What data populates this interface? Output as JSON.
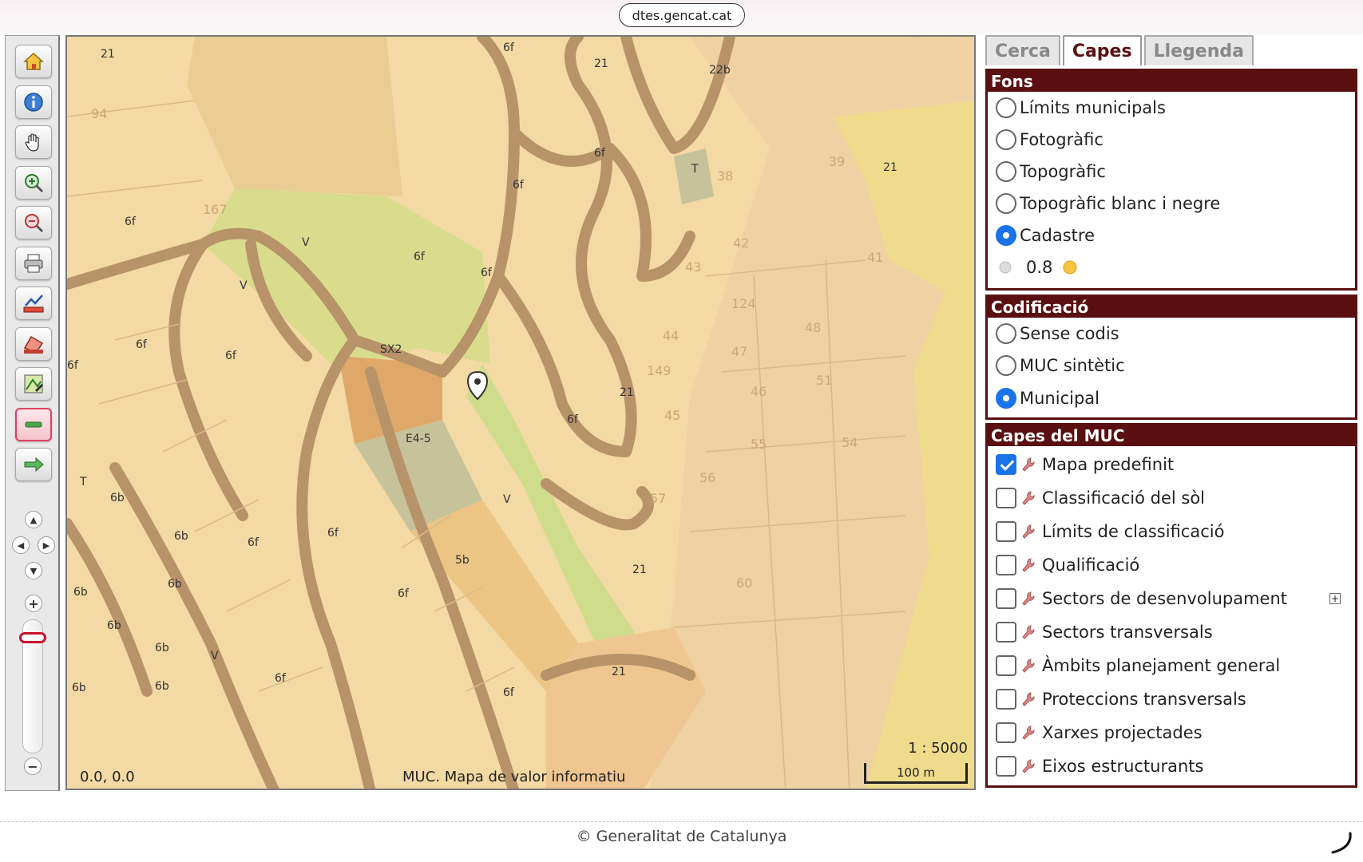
{
  "browser": {
    "url": "dtes.gencat.cat"
  },
  "map": {
    "coords": "0.0, 0.0",
    "title": "MUC. Mapa de valor informatiu",
    "scale_ratio": "1 : 5000",
    "scale_bar": "100 m",
    "labels": [
      "6f",
      "21",
      "22b",
      "6f",
      "6f",
      "T",
      "38",
      "39",
      "21",
      "167",
      "V",
      "V",
      "6f",
      "6f",
      "6f",
      "42",
      "43",
      "124",
      "41",
      "SX2",
      "6f",
      "6f",
      "44",
      "47",
      "48",
      "149",
      "46",
      "51",
      "21",
      "E4-5",
      "45",
      "55",
      "54",
      "6b",
      "5b",
      "6f",
      "56",
      "57",
      "6b",
      "6b",
      "6f",
      "6b",
      "21",
      "60",
      "6b",
      "6b",
      "V",
      "6f",
      "6b",
      "6b",
      "6f",
      "21",
      "V",
      "T",
      "94"
    ]
  },
  "panel": {
    "tabs": [
      {
        "label": "Cerca",
        "selected": false
      },
      {
        "label": "Capes",
        "selected": true
      },
      {
        "label": "Llegenda",
        "selected": false
      }
    ],
    "fons": {
      "title": "Fons",
      "options": [
        {
          "label": "Límits municipals",
          "checked": false
        },
        {
          "label": "Fotogràfic",
          "checked": false
        },
        {
          "label": "Topogràfic",
          "checked": false
        },
        {
          "label": "Topogràfic blanc i negre",
          "checked": false
        },
        {
          "label": "Cadastre",
          "checked": true
        }
      ],
      "opacity": "0.8"
    },
    "codificacio": {
      "title": "Codificació",
      "options": [
        {
          "label": "Sense codis",
          "checked": false
        },
        {
          "label": "MUC sintètic",
          "checked": false
        },
        {
          "label": "Municipal",
          "checked": true
        }
      ]
    },
    "capes": {
      "title": "Capes del MUC",
      "layers": [
        {
          "label": "Mapa predefinit",
          "checked": true
        },
        {
          "label": "Classificació del sòl",
          "checked": false
        },
        {
          "label": "Límits de classificació",
          "checked": false
        },
        {
          "label": "Qualificació",
          "checked": false
        },
        {
          "label": "Sectors de desenvolupament",
          "checked": false
        },
        {
          "label": "Sectors transversals",
          "checked": false
        },
        {
          "label": "Àmbits planejament general",
          "checked": false
        },
        {
          "label": "Proteccions transversals",
          "checked": false
        },
        {
          "label": "Xarxes projectades",
          "checked": false
        },
        {
          "label": "Eixos estructurants",
          "checked": false
        }
      ]
    }
  },
  "footer": {
    "copyright": "© Generalitat de Catalunya"
  },
  "colors": {
    "panel_header": "#5a1010",
    "accent": "#1a73e8",
    "parcel": "#f3d9a3",
    "road": "#b8936a",
    "green": "#d8dc8c"
  }
}
